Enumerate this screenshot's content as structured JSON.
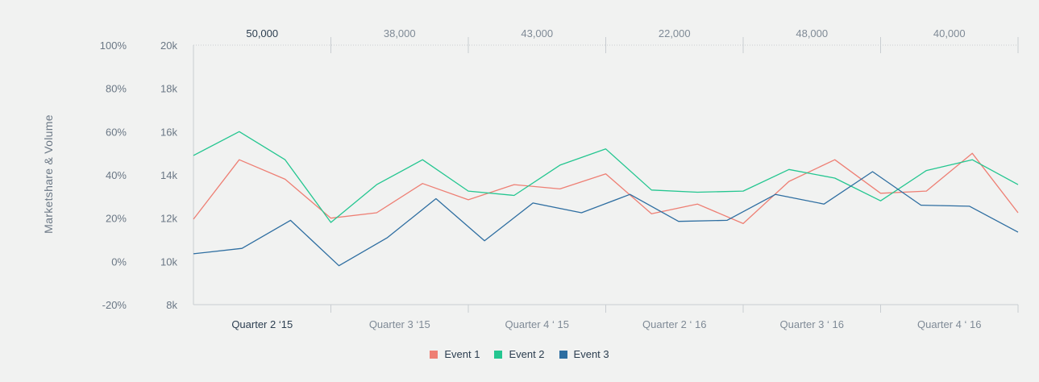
{
  "chart_data": {
    "type": "line",
    "ylabel": "Marketshare & Volume",
    "y_left_ticks": [
      "100%",
      "80%",
      "60%",
      "40%",
      "20%",
      "0%",
      "-20%"
    ],
    "y_right_ticks": [
      "20k",
      "18k",
      "16k",
      "14k",
      "12k",
      "10k",
      "8k"
    ],
    "ylim_percent": [
      -20,
      100
    ],
    "ylim_volume": [
      8000,
      20000
    ],
    "categories": [
      "Quarter 2 ‘15",
      "Quarter 3 ‘15",
      "Quarter 4 ‘ 15",
      "Quarter 2 ‘ 16",
      "Quarter 3 ‘ 16",
      "Quarter 4 ‘ 16"
    ],
    "active_category": 0,
    "top_values": [
      "50,000",
      "38,000",
      "43,000",
      "22,000",
      "48,000",
      "40,000"
    ],
    "x": [
      0,
      0.68,
      1.36,
      2.04,
      2.72,
      3.4,
      4.08,
      4.76,
      5.44,
      6.12,
      6.8,
      7.48,
      8.16,
      8.84,
      9.52,
      10.2,
      10.88,
      11.56,
      12.24,
      12.92,
      13.6,
      14.28,
      14.96,
      15.64,
      16.32,
      17.0,
      17.68,
      18.36
    ],
    "series": [
      {
        "name": "Event 1",
        "color": "#ee7f74",
        "values": [
          19.5,
          47,
          38,
          20,
          22.5,
          36,
          28.5,
          35.5,
          33.5,
          40.5,
          22,
          26.5,
          17.5,
          37,
          47,
          31.5,
          32.5,
          50,
          22.5
        ]
      },
      {
        "name": "Event 2",
        "color": "#24c690",
        "values": [
          49,
          60,
          47,
          18,
          35.5,
          47,
          32.5,
          30.5,
          44.5,
          52,
          33,
          32,
          32.5,
          42.5,
          38.5,
          28,
          42,
          47,
          35.5
        ]
      },
      {
        "name": "Event 3",
        "color": "#2e6ea1",
        "values": [
          3.5,
          6,
          19,
          -2,
          11,
          29,
          9.5,
          27,
          22.5,
          31,
          18.5,
          19,
          31,
          26.5,
          41.5,
          26,
          25.5,
          13.5
        ]
      }
    ],
    "grid": false,
    "legend_position": "bottom-center"
  }
}
